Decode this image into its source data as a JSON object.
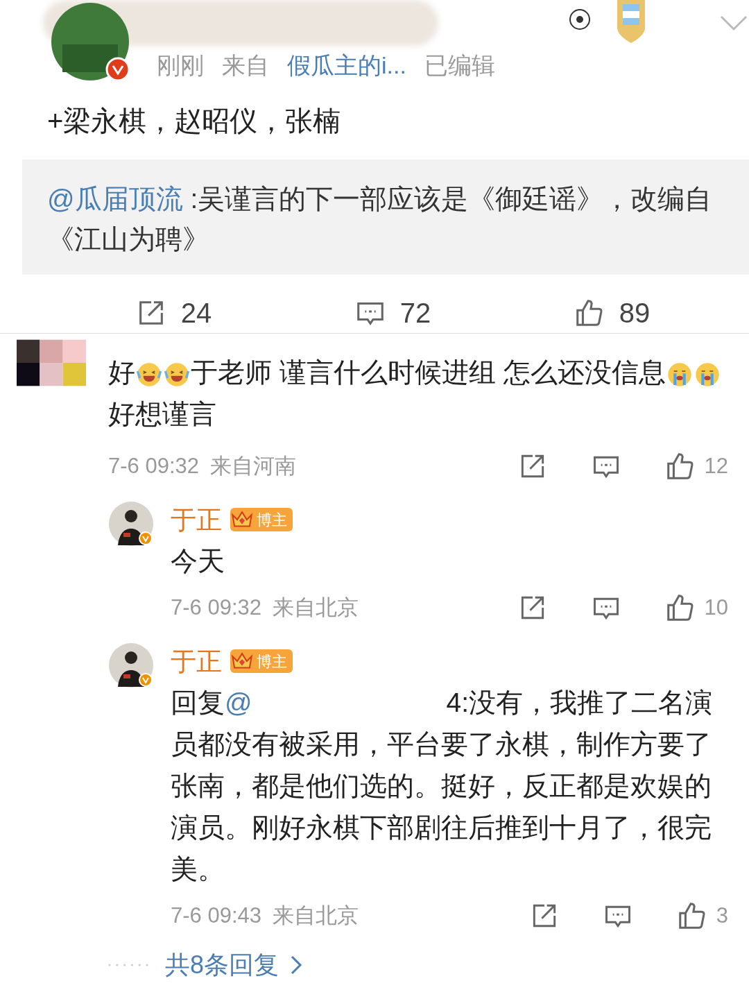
{
  "post": {
    "meta": [
      {
        "kind": "time",
        "text": "刚刚"
      },
      {
        "kind": "plain",
        "text": "来自"
      },
      {
        "kind": "link",
        "text": "假瓜主的i..."
      },
      {
        "kind": "plain",
        "text": "已编辑"
      }
    ],
    "text": "+梁永棋，赵昭仪，张楠",
    "quote": {
      "mention": "@瓜届顶流",
      "text": " :吴谨言的下一部应该是《御廷谣》，改编自《江山为聘》"
    },
    "actions": [
      {
        "kind": "share",
        "count": "24"
      },
      {
        "kind": "comment",
        "count": "72"
      },
      {
        "kind": "like",
        "count": "89"
      }
    ]
  },
  "comment": {
    "segments": [
      {
        "kind": "text",
        "text": "好"
      },
      {
        "kind": "laugh"
      },
      {
        "kind": "laugh"
      },
      {
        "kind": "text",
        "text": "于老师 谨言什么时候进组 怎么还没信息"
      },
      {
        "kind": "cry"
      },
      {
        "kind": "cry"
      },
      {
        "kind": "text",
        "text": "好想谨言"
      }
    ],
    "time": "7-6 09:32",
    "location": "来自河南",
    "likes": "12"
  },
  "replies": [
    {
      "name": "于正",
      "badge": "博主",
      "text": "今天",
      "time": "7-6 09:32",
      "location": "来自北京",
      "likes": "10"
    },
    {
      "name": "于正",
      "badge": "博主",
      "prefix": "回复@",
      "text": "4:没有，我推了二名演员都没有被采用，平台要了永棋，制作方要了张南，都是他们选的。挺好，反正都是欢娱的演员。刚好永棋下部剧往后推到十月了，很完美。",
      "time": "7-6 09:43",
      "location": "来自北京",
      "likes": "3"
    }
  ],
  "more_replies": "共8条回复"
}
